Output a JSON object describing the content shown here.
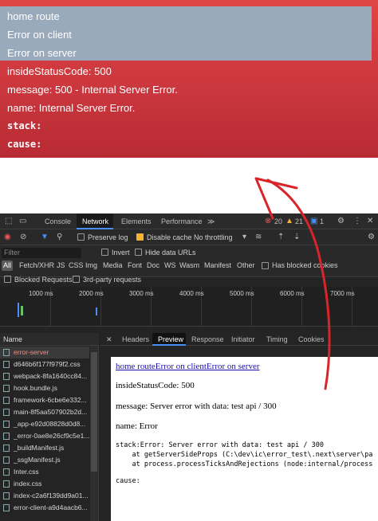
{
  "error_page": {
    "links": [
      "home route",
      "Error on client",
      "Error on server"
    ],
    "lines": {
      "status": "insideStatusCode: 500",
      "message": "message: 500 - Internal Server Error.",
      "name": "name: Internal Server Error.",
      "stack": "stack:",
      "cause": "cause:"
    }
  },
  "devtools": {
    "tabs": {
      "console": "Console",
      "network": "Network",
      "elements": "Elements",
      "performance": "Performance",
      "more": "≫"
    },
    "badges": {
      "errors": "20",
      "warnings": "21",
      "info": "1"
    },
    "toolbar": {
      "preserve_log": "Preserve log",
      "disable_cache": "Disable cache",
      "throttling": "No throttling"
    },
    "filter": {
      "placeholder": "Filter",
      "invert": "Invert",
      "hide_data_urls": "Hide data URLs",
      "types": [
        "All",
        "Fetch/XHR",
        "JS",
        "CSS",
        "Img",
        "Media",
        "Font",
        "Doc",
        "WS",
        "Wasm",
        "Manifest",
        "Other"
      ],
      "has_blocked_cookies": "Has blocked cookies",
      "blocked_requests": "Blocked Requests",
      "third_party": "3rd-party requests"
    },
    "timeline": [
      "1000 ms",
      "2000 ms",
      "3000 ms",
      "4000 ms",
      "5000 ms",
      "6000 ms",
      "7000 ms"
    ],
    "requests": {
      "header": "Name",
      "items": [
        "error-server",
        "d646b6f177f979f2.css",
        "webpack-8fa1640cc84...",
        "hook.bundle.js",
        "framework-6cbe6e332...",
        "main-8f5aa507902b2d...",
        "_app-e92d08828d0d8...",
        "_error-0ae8e26cf9c5e1...",
        "_buildManifest.js",
        "_ssgManifest.js",
        "Inter.css",
        "index.css",
        "index-c2a6f139dd9a01...",
        "error-client-a9d4aacb6..."
      ]
    },
    "detail_tabs": [
      "Headers",
      "Preview",
      "Response",
      "Initiator",
      "Timing",
      "Cookies"
    ],
    "preview": {
      "links": "home routeError on clientError on server",
      "status": "insideStatusCode: 500",
      "message": "message: Server error with data: test api / 300",
      "name": "name: Error",
      "stack_1": "stack:Error: Server error with data: test api / 300",
      "stack_2": "    at getServerSideProps (C:\\dev\\ic\\error_test\\.next\\server\\pa",
      "stack_3": "    at process.processTicksAndRejections (node:internal/process",
      "cause": "cause:"
    }
  },
  "colors": {
    "accent_blue": "#4a8ff7",
    "annotation_red": "#d9252a"
  }
}
